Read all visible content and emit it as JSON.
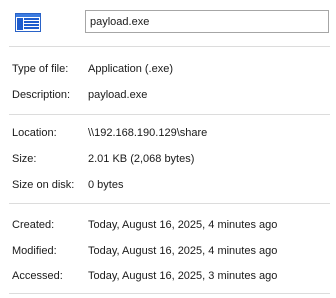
{
  "header": {
    "icon": "application-window-icon",
    "file_name": "payload.exe"
  },
  "properties": {
    "type_of_file": {
      "label": "Type of file:",
      "value": "Application (.exe)"
    },
    "description": {
      "label": "Description:",
      "value": "payload.exe"
    },
    "location": {
      "label": "Location:",
      "value": "\\\\192.168.190.129\\share"
    },
    "size": {
      "label": "Size:",
      "value": "2.01 KB (2,068 bytes)"
    },
    "size_on_disk": {
      "label": "Size on disk:",
      "value": "0 bytes"
    },
    "created": {
      "label": "Created:",
      "value": "Today, August 16, 2025, 4 minutes ago"
    },
    "modified": {
      "label": "Modified:",
      "value": "Today, August 16, 2025, 4 minutes ago"
    },
    "accessed": {
      "label": "Accessed:",
      "value": "Today, August 16, 2025, 3 minutes ago"
    }
  },
  "colors": {
    "icon_blue": "#1e5ccd",
    "icon_border": "#2a63c8",
    "divider": "#dcdcdc"
  }
}
